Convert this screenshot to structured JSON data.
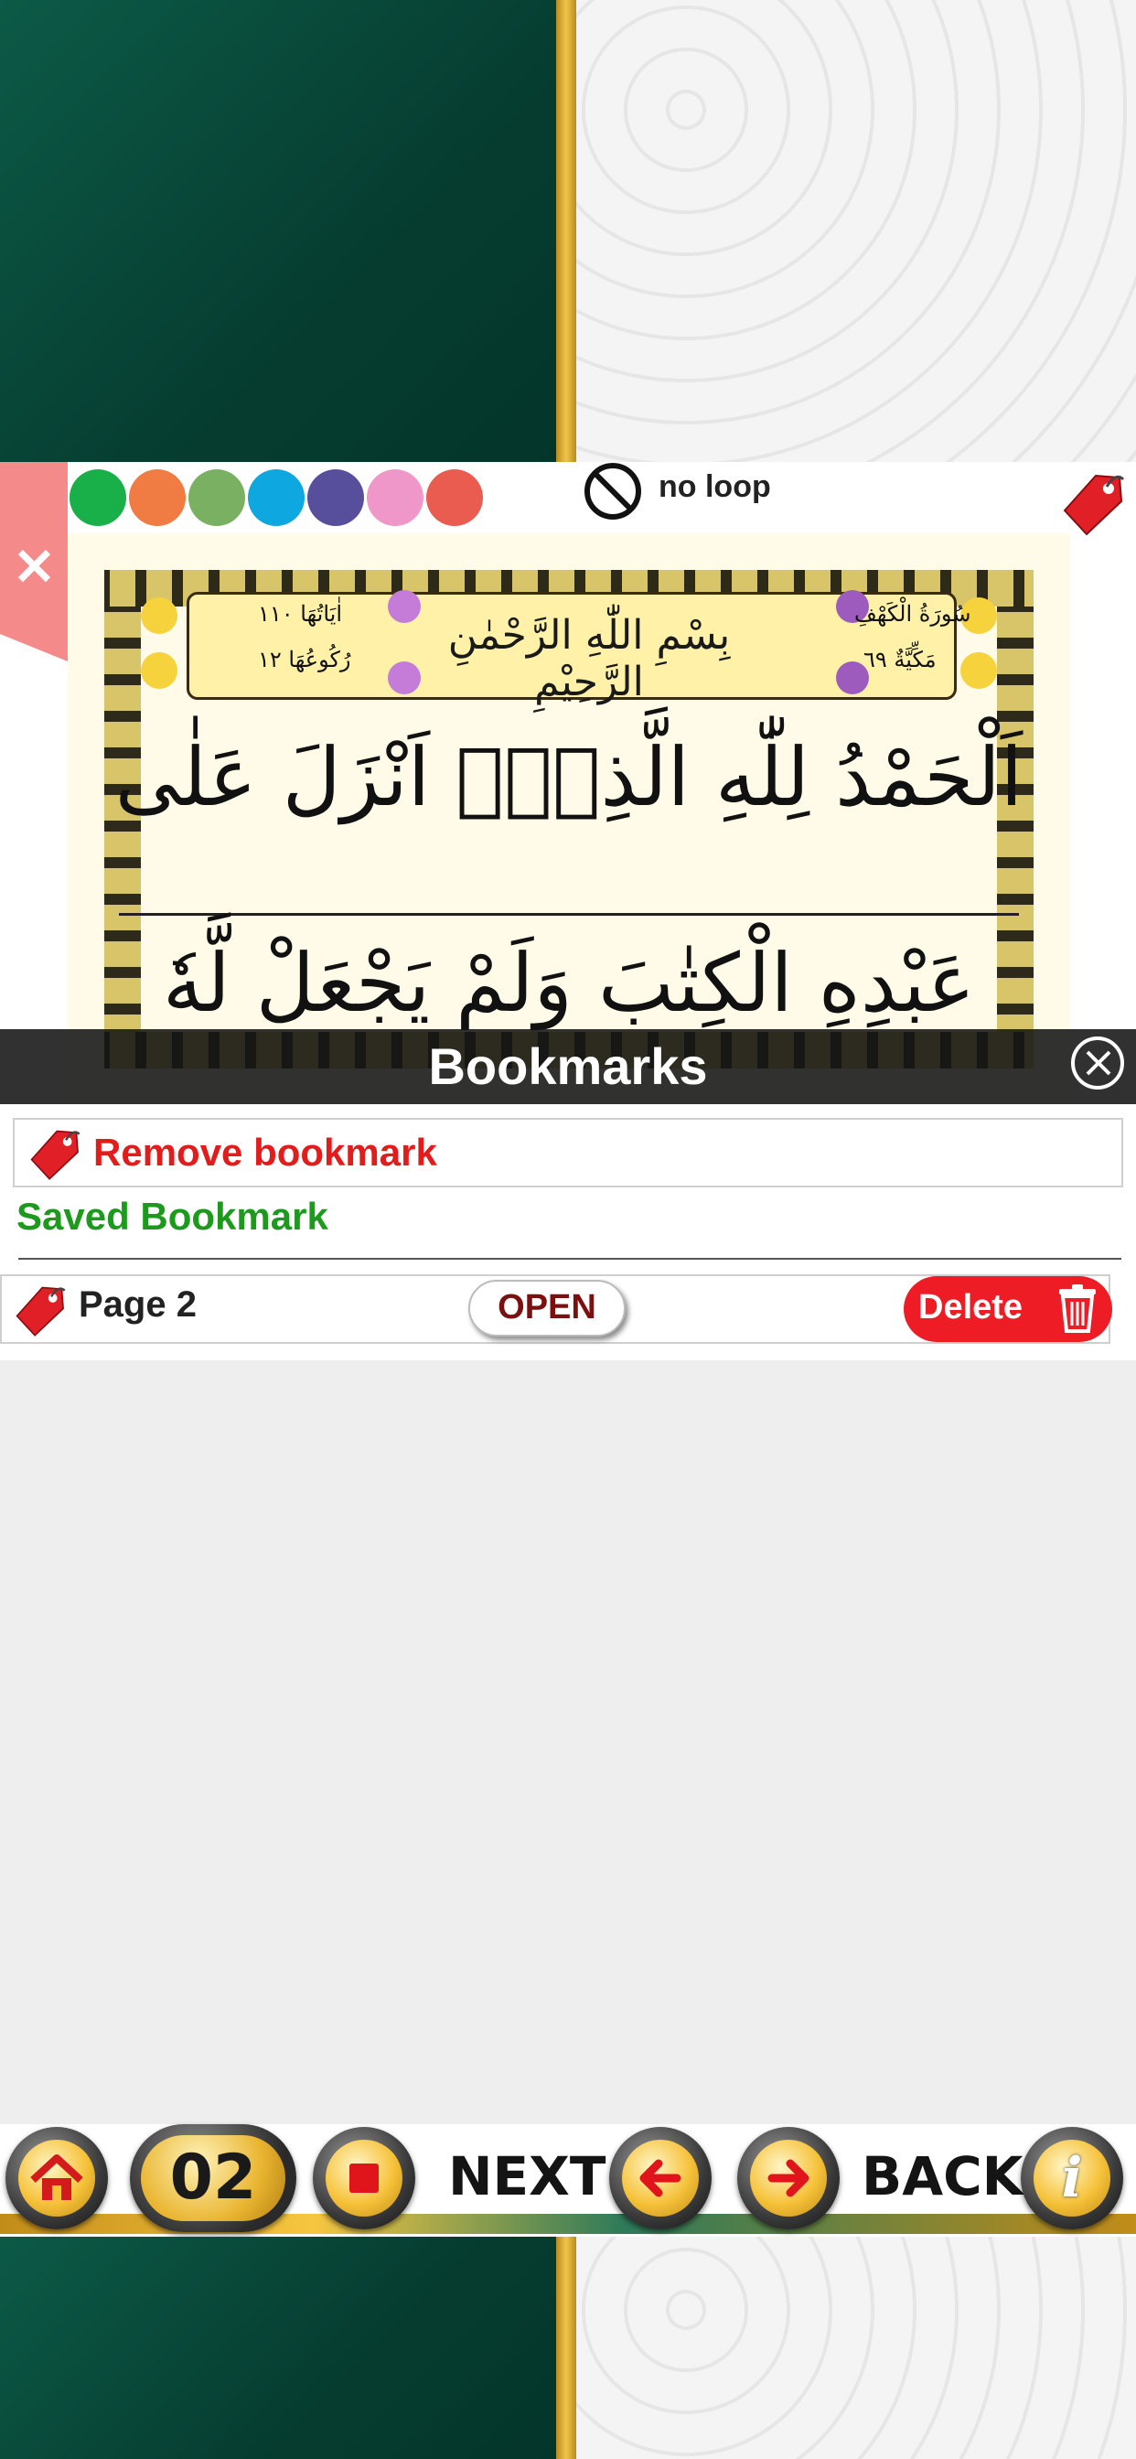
{
  "colors": {
    "swatches": [
      "#19b04a",
      "#f07c44",
      "#7ab061",
      "#0fa7e0",
      "#574f9c",
      "#ef97c8",
      "#ea5b50"
    ],
    "bookmarks_bar": "#1e1e1e",
    "remove_text": "#e21b1b",
    "saved_text": "#1b9a1b",
    "delete_button": "#ee1c24"
  },
  "top_toolbar": {
    "close_icon": "close-icon",
    "loop_icon": "no-loop-icon",
    "loop_label": "no loop",
    "bookmark_icon": "bookmark-tag-icon"
  },
  "quran_page": {
    "surah_name": "سُورَةُ الْكَهْفِ",
    "surah_type": "مَكِّيَّةٌ ٦٩",
    "ayat_count": "اٰيَاتُهَا ١١٠",
    "ruku_count": "رُكُوعُهَا ١٢",
    "bismillah": "بِسْمِ اللّٰهِ الرَّحْمٰنِ الرَّحِيْمِ",
    "line1": "اَلْحَمْدُ لِلّٰهِ الَّذِیْۤ اَنْزَلَ عَلٰی",
    "line2": "عَبْدِهِ الْكِتٰبَ وَلَمْ یَجْعَلْ لَّهٗ"
  },
  "bookmarks": {
    "title": "Bookmarks",
    "remove_label": "Remove bookmark",
    "saved_heading": "Saved Bookmark",
    "items": [
      {
        "page_label": "Page  2",
        "open_label": "OPEN",
        "delete_label": "Delete"
      }
    ]
  },
  "bottom_toolbar": {
    "page_number": "02",
    "next_label": "NEXT",
    "back_label": "BACK",
    "home_icon": "home-icon",
    "stop_icon": "stop-icon",
    "left_arrow_icon": "arrow-left-icon",
    "right_arrow_icon": "arrow-right-icon",
    "info_icon": "info-icon"
  }
}
